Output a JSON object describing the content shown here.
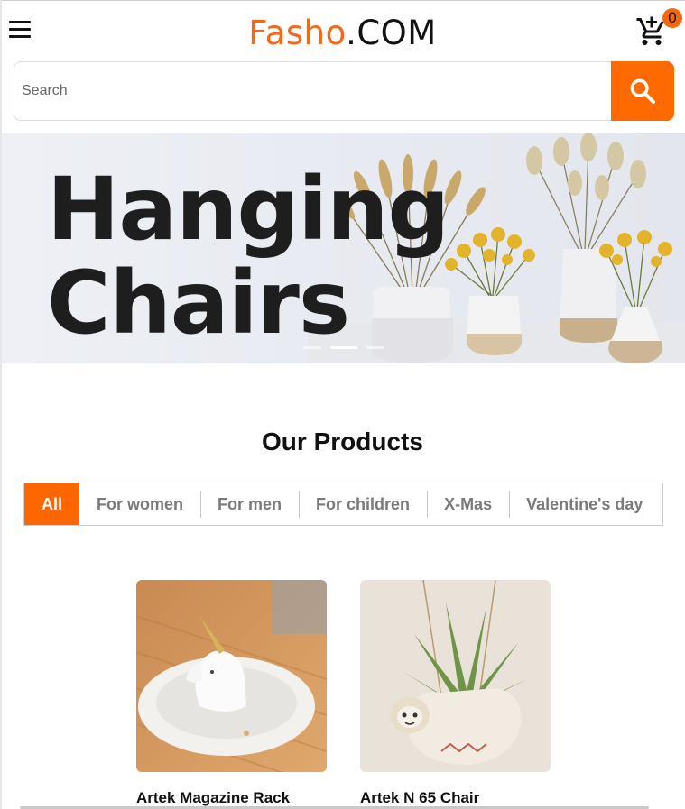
{
  "header": {
    "brand_part1": "Fasho",
    "brand_part2": ".COM",
    "menu_icon": "hamburger-menu-icon",
    "cart_icon": "add-to-cart-icon",
    "cart_count": "0",
    "accent_color": "#ff6600"
  },
  "search": {
    "placeholder": "Search",
    "value": "",
    "button_icon": "search-icon"
  },
  "hero": {
    "line1": "Hanging",
    "line2": "Chairs",
    "slide_count": 3,
    "active_slide": 2
  },
  "products": {
    "title": "Our Products",
    "tabs": [
      {
        "label": "All",
        "active": true
      },
      {
        "label": "For women",
        "active": false
      },
      {
        "label": "For men",
        "active": false
      },
      {
        "label": "For children",
        "active": false
      },
      {
        "label": "X-Mas",
        "active": false
      },
      {
        "label": "Valentine's day",
        "active": false
      }
    ],
    "items": [
      {
        "name": "Artek Magazine Rack",
        "image": "unicorn-ring-dish-image"
      },
      {
        "name": "Artek N 65 Chair",
        "image": "sloth-planter-image"
      }
    ]
  }
}
